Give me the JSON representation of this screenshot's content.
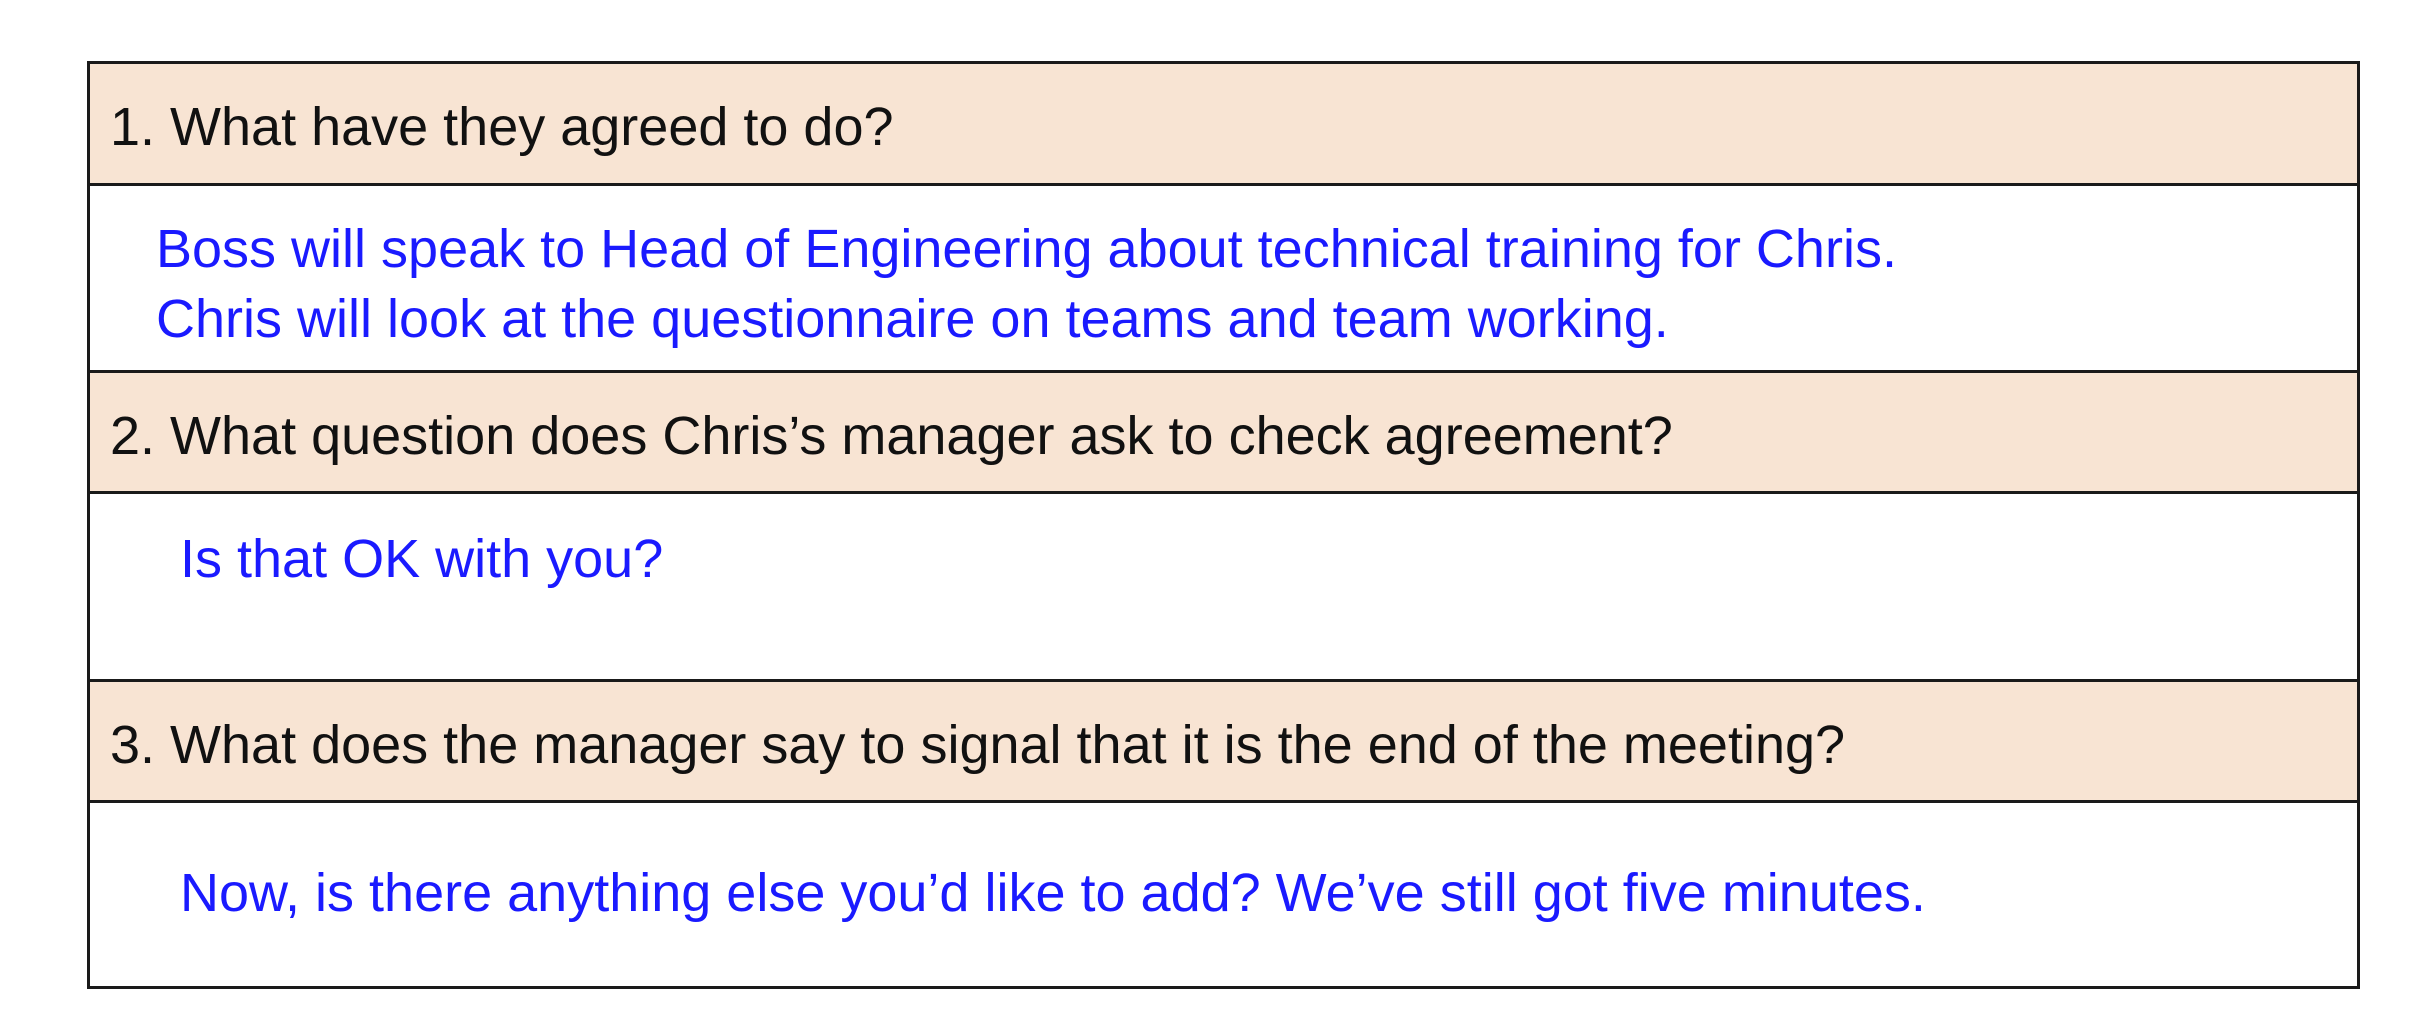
{
  "qa": [
    {
      "question": "1. What have they agreed to do?",
      "answer_lines": [
        "Boss will speak to Head of Engineering about technical training for Chris.",
        "Chris will look at the questionnaire on teams and team working."
      ]
    },
    {
      "question": "2. What question does Chris’s manager ask to check agreement?",
      "answer_lines": [
        "Is that OK with you?"
      ]
    },
    {
      "question": "3. What does the manager say to signal that it is the end of the meeting?",
      "answer_lines": [
        "Now, is there anything else you’d like to add? We’ve still got five minutes."
      ]
    }
  ],
  "colors": {
    "question_bg": "#f8e4d3",
    "answer_text": "#1a1aff",
    "border": "#1a1a1a"
  }
}
